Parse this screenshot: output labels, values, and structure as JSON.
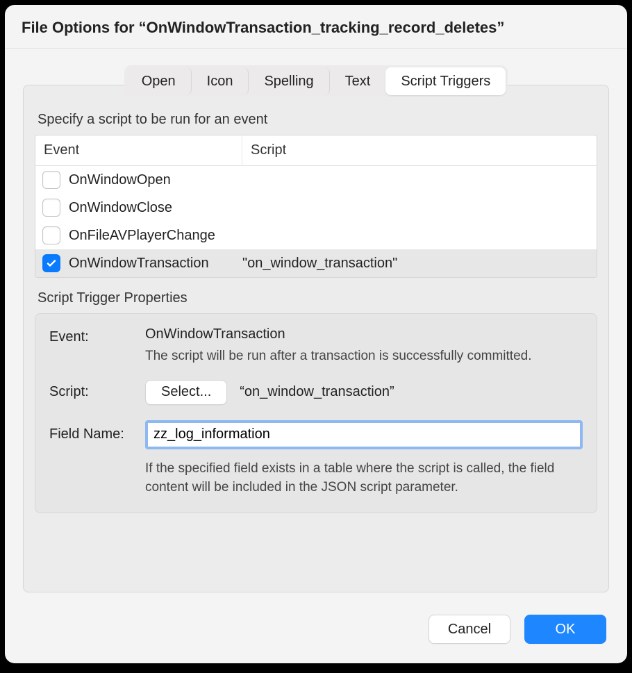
{
  "title": "File Options for “OnWindowTransaction_tracking_record_deletes”",
  "tabs": {
    "items": [
      {
        "label": "Open"
      },
      {
        "label": "Icon"
      },
      {
        "label": "Spelling"
      },
      {
        "label": "Text"
      },
      {
        "label": "Script Triggers"
      }
    ],
    "active_index": 4
  },
  "instruction": "Specify a script to be run for an event",
  "table": {
    "headers": {
      "event": "Event",
      "script": "Script"
    },
    "rows": [
      {
        "checked": false,
        "event": "OnWindowOpen",
        "script": ""
      },
      {
        "checked": false,
        "event": "OnWindowClose",
        "script": ""
      },
      {
        "checked": false,
        "event": "OnFileAVPlayerChange",
        "script": ""
      },
      {
        "checked": true,
        "event": "OnWindowTransaction",
        "script": "\"on_window_transaction\""
      }
    ],
    "selected_index": 3
  },
  "properties": {
    "heading": "Script Trigger Properties",
    "event_label": "Event:",
    "event_name": "OnWindowTransaction",
    "event_help": "The script will be run after a transaction is successfully committed.",
    "script_label": "Script:",
    "select_button": "Select...",
    "script_name": "“on_window_transaction”",
    "field_label": "Field Name:",
    "field_value": "zz_log_information",
    "field_help": "If the specified field exists in a table where the script is called, the field content will be included in the JSON script parameter."
  },
  "buttons": {
    "cancel": "Cancel",
    "ok": "OK"
  }
}
